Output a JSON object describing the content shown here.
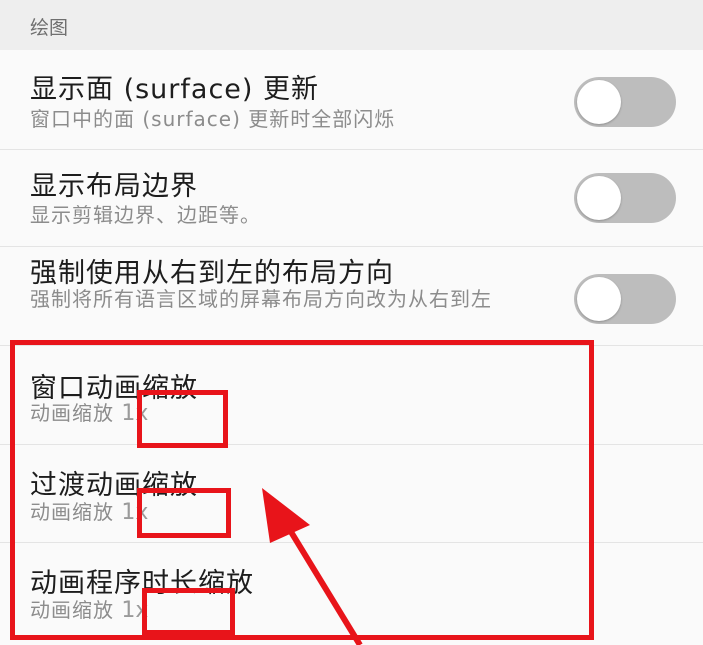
{
  "section": {
    "title": "绘图"
  },
  "rows": [
    {
      "title": "显示面 (surface) 更新",
      "summary": "窗口中的面 (surface) 更新时全部闪烁",
      "toggle_on": false
    },
    {
      "title": "显示布局边界",
      "summary": "显示剪辑边界、边距等。",
      "toggle_on": false
    },
    {
      "title": "强制使用从右到左的布局方向",
      "summary": "强制将所有语言区域的屏幕布局方向改为从右到左",
      "toggle_on": false
    },
    {
      "title": "窗口动画缩放",
      "summary_prefix": "动画缩放",
      "value": "1x"
    },
    {
      "title": "过渡动画缩放",
      "summary_prefix": "动画缩放",
      "value": "1x"
    },
    {
      "title": "动画程序时长缩放",
      "summary_prefix": "动画缩放",
      "value": "1x"
    }
  ],
  "colors": {
    "highlight": "#e8141a",
    "toggle_off_track": "#bdbdbd"
  }
}
